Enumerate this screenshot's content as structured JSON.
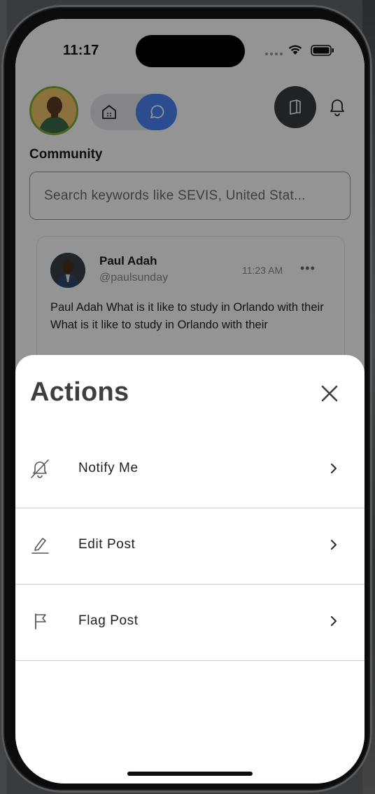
{
  "status_bar": {
    "time": "11:17"
  },
  "header": {
    "section_title": "Community"
  },
  "search": {
    "placeholder": "Search keywords like SEVIS, United Stat..."
  },
  "post": {
    "author_name": "Paul Adah",
    "author_handle": "@paulsunday",
    "time": "11:23 AM",
    "more_label": "•••",
    "body": "Paul Adah What is it like to study in Orlando with their What is it like to study in Orlando with their"
  },
  "sheet": {
    "title": "Actions",
    "actions": [
      {
        "label": "Notify Me",
        "icon": "bell-off-icon"
      },
      {
        "label": "Edit Post",
        "icon": "pencil-icon"
      },
      {
        "label": "Flag Post",
        "icon": "flag-icon"
      }
    ]
  },
  "colors": {
    "accent_blue": "#4b84f5",
    "avatar_ring": "#7fb03a",
    "sheet_title": "#3e3e42"
  }
}
